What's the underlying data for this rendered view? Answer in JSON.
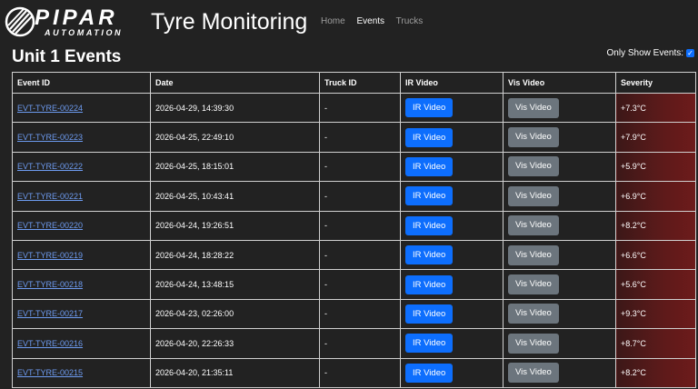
{
  "nav": {
    "logo_text": "PIPAR",
    "logo_subtext": "AUTOMATION",
    "title": "Tyre Monitoring",
    "links": [
      {
        "label": "Home",
        "active": false
      },
      {
        "label": "Events",
        "active": true
      },
      {
        "label": "Trucks",
        "active": false
      }
    ]
  },
  "page": {
    "heading": "Unit 1 Events",
    "filter_label": "Only Show Events:",
    "filter_checked": true
  },
  "table": {
    "headers": [
      "Event ID",
      "Date",
      "Truck ID",
      "IR Video",
      "Vis Video",
      "Severity"
    ],
    "ir_button_label": "IR Video",
    "vis_button_label": "Vis Video",
    "rows": [
      {
        "id": "EVT-TYRE-00224",
        "date": "2026-04-29, 14:39:30",
        "truck": "-",
        "severity": "+7.3°C"
      },
      {
        "id": "EVT-TYRE-00223",
        "date": "2026-04-25, 22:49:10",
        "truck": "-",
        "severity": "+7.9°C"
      },
      {
        "id": "EVT-TYRE-00222",
        "date": "2026-04-25, 18:15:01",
        "truck": "-",
        "severity": "+5.9°C"
      },
      {
        "id": "EVT-TYRE-00221",
        "date": "2026-04-25, 10:43:41",
        "truck": "-",
        "severity": "+6.9°C"
      },
      {
        "id": "EVT-TYRE-00220",
        "date": "2026-04-24, 19:26:51",
        "truck": "-",
        "severity": "+8.2°C"
      },
      {
        "id": "EVT-TYRE-00219",
        "date": "2026-04-24, 18:28:22",
        "truck": "-",
        "severity": "+6.6°C"
      },
      {
        "id": "EVT-TYRE-00218",
        "date": "2026-04-24, 13:48:15",
        "truck": "-",
        "severity": "+5.6°C"
      },
      {
        "id": "EVT-TYRE-00217",
        "date": "2026-04-23, 02:26:00",
        "truck": "-",
        "severity": "+9.3°C"
      },
      {
        "id": "EVT-TYRE-00216",
        "date": "2026-04-20, 22:26:33",
        "truck": "-",
        "severity": "+8.7°C"
      },
      {
        "id": "EVT-TYRE-00215",
        "date": "2026-04-20, 21:35:11",
        "truck": "-",
        "severity": "+8.2°C"
      }
    ]
  }
}
